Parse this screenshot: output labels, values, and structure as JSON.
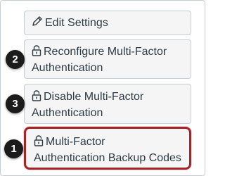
{
  "buttons": {
    "edit": {
      "label": "Edit Settings",
      "icon": "pencil-icon"
    },
    "reconfigure": {
      "line1": "Reconfigure Multi-Factor",
      "line2": "Authentication",
      "icon": "lock-icon"
    },
    "disable": {
      "line1": "Disable Multi-Factor",
      "line2": "Authentication",
      "icon": "lock-icon"
    },
    "backup": {
      "line1": "Multi-Factor",
      "line2": "Authentication Backup Codes",
      "icon": "lock-icon"
    }
  },
  "callouts": {
    "reconfigure": "2",
    "disable": "3",
    "backup": "1"
  },
  "colors": {
    "highlight": "#a3252a",
    "text": "#2d3b45",
    "button_bg": "#f5f5f5",
    "badge_bg": "#1b1b1b"
  }
}
